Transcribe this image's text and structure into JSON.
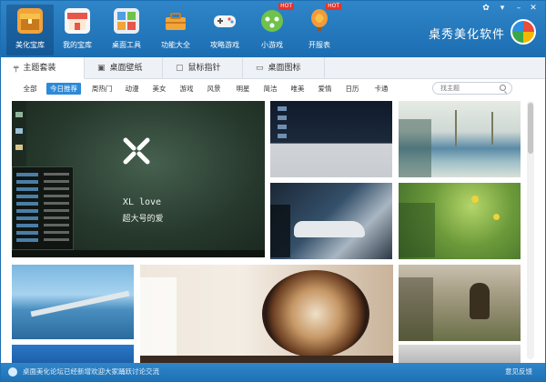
{
  "nav": {
    "items": [
      {
        "label": "美化宝库",
        "icon": "treasure-box-icon",
        "color": "#f2a33a"
      },
      {
        "label": "我的宝库",
        "icon": "shop-icon",
        "color": "#e8554b"
      },
      {
        "label": "桌面工具",
        "icon": "desktop-tools-icon",
        "color": "#4f9fe0"
      },
      {
        "label": "功能大全",
        "icon": "toolbox-icon",
        "color": "#f1a53a"
      },
      {
        "label": "攻略游戏",
        "icon": "gamepad-icon",
        "color": "#ffffff"
      },
      {
        "label": "小游戏",
        "icon": "mini-game-icon",
        "color": "#6fc24a",
        "badge": "HOT"
      },
      {
        "label": "开服表",
        "icon": "balloon-icon",
        "color": "#f39a3a",
        "badge": "HOT"
      }
    ],
    "brand": "桌秀美化软件"
  },
  "tabs": [
    {
      "label": "主题套装",
      "icon": "paint-brush-icon"
    },
    {
      "label": "桌面壁纸",
      "icon": "image-icon"
    },
    {
      "label": "鼠标指针",
      "icon": "cursor-icon"
    },
    {
      "label": "桌面图标",
      "icon": "monitor-icon"
    }
  ],
  "categories": [
    "全部",
    "今日推荐",
    "周热门",
    "动漫",
    "美女",
    "游戏",
    "风景",
    "明星",
    "简洁",
    "唯美",
    "爱情",
    "日历",
    "卡通"
  ],
  "search": {
    "placeholder": "找主题"
  },
  "featured": {
    "title_line1": "XL love",
    "title_line2": "超大号的爱"
  },
  "status": {
    "text": "桌面美化论坛已经新增欢迎大家踊跃讨论交流",
    "right": "意见反馈"
  },
  "colors": {
    "accent": "#2c8ad8",
    "header": "#1b6db1"
  }
}
